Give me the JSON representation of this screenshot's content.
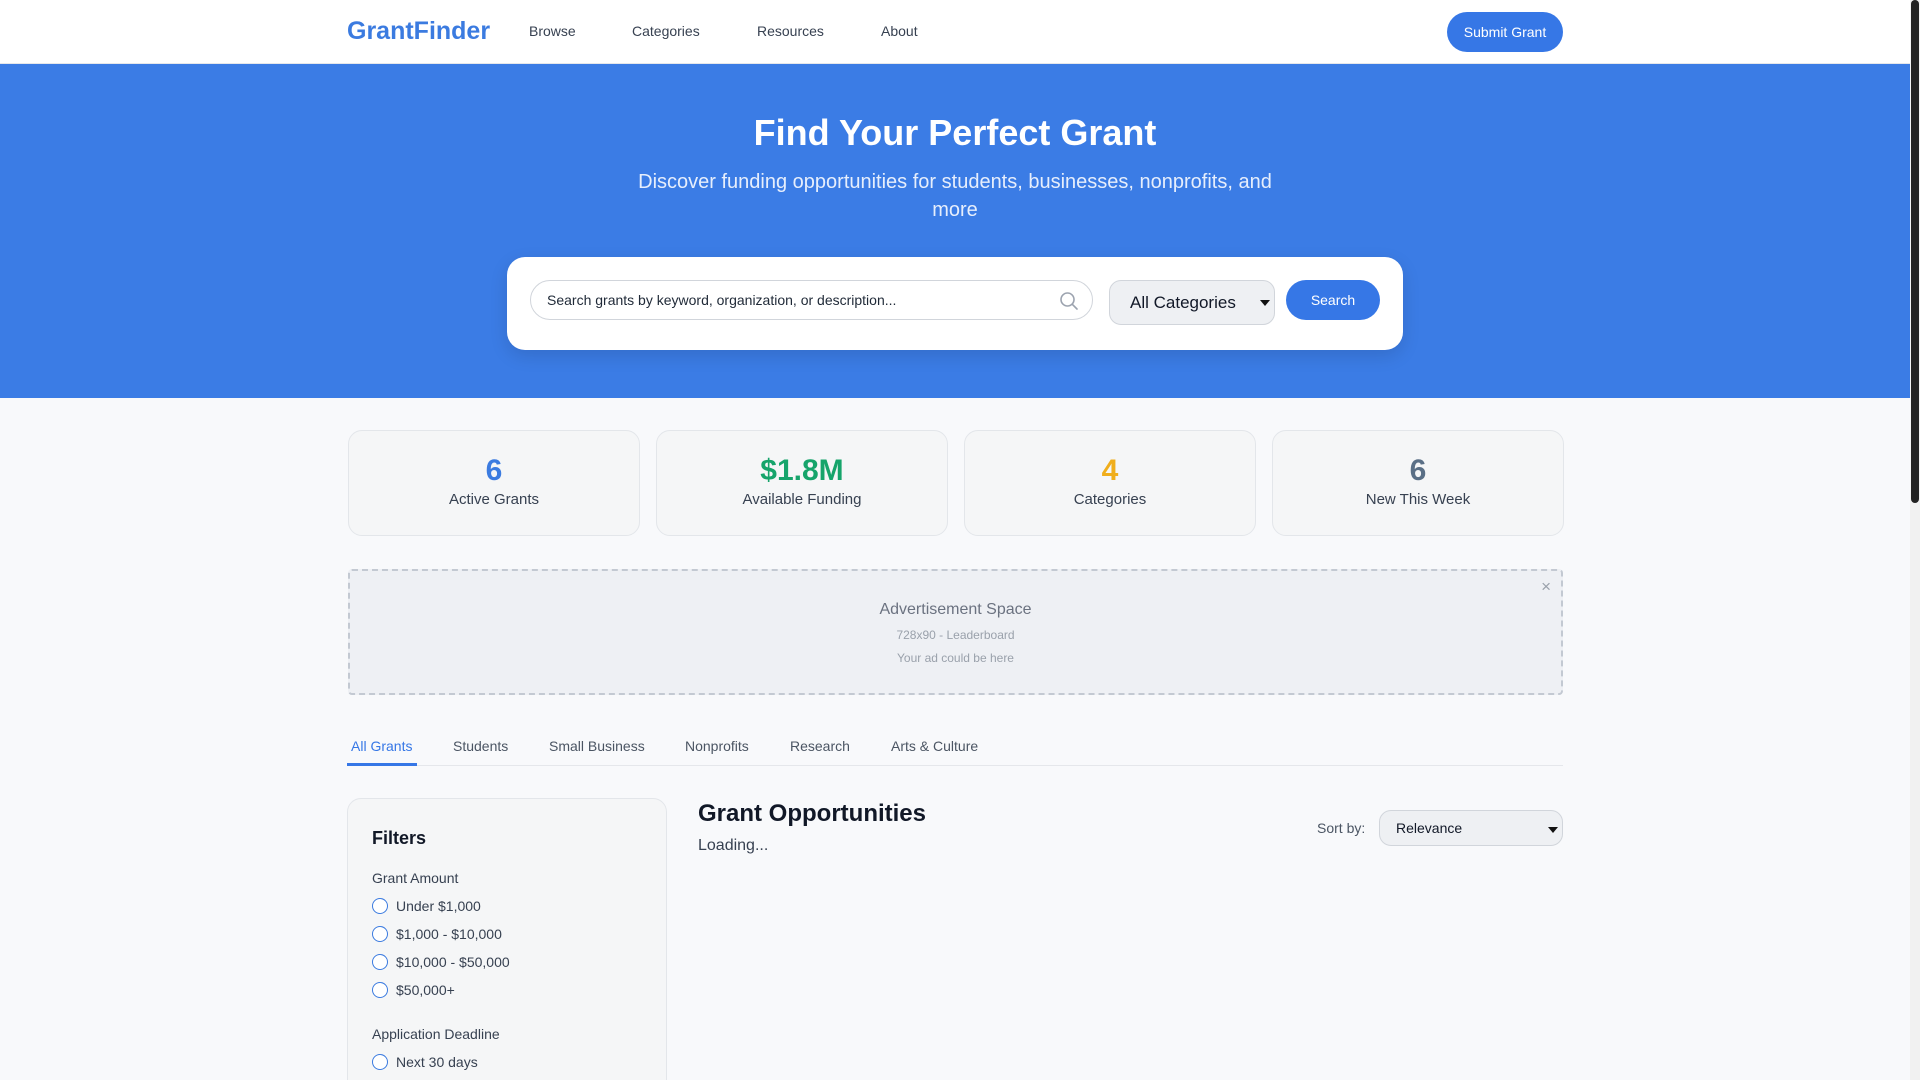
{
  "header": {
    "logo": "GrantFinder",
    "nav": [
      "Browse",
      "Categories",
      "Resources",
      "About"
    ],
    "submit_label": "Submit Grant"
  },
  "hero": {
    "title": "Find Your Perfect Grant",
    "subtitle": "Discover funding opportunities for students, businesses, nonprofits, and more",
    "search_placeholder": "Search grants by keyword, organization, or description...",
    "category_selected": "All Categories",
    "search_label": "Search"
  },
  "stats": [
    {
      "value": "6",
      "label": "Active Grants",
      "color": "#3b7be0"
    },
    {
      "value": "$1.8M",
      "label": "Available Funding",
      "color": "#16a46b"
    },
    {
      "value": "4",
      "label": "Categories",
      "color": "#f0ae1c"
    },
    {
      "value": "6",
      "label": "New This Week",
      "color": "#5a6f86"
    }
  ],
  "ad": {
    "title": "Advertisement Space",
    "size": "728x90 - Leaderboard",
    "note": "Your ad could be here",
    "close": "×"
  },
  "tabs": [
    "All Grants",
    "Students",
    "Small Business",
    "Nonprofits",
    "Research",
    "Arts & Culture"
  ],
  "filters": {
    "title": "Filters",
    "amount_label": "Grant Amount",
    "amount_options": [
      "Under $1,000",
      "$1,000 - $10,000",
      "$10,000 - $50,000",
      "$50,000+"
    ],
    "deadline_label": "Application Deadline",
    "deadline_options": [
      "Next 30 days"
    ]
  },
  "results": {
    "title": "Grant Opportunities",
    "status": "Loading...",
    "sort_label": "Sort by:",
    "sort_selected": "Relevance"
  },
  "colors": {
    "brand": "#3b7be0",
    "hero_bg": "#3b7ce5",
    "button": "#3677e6"
  }
}
